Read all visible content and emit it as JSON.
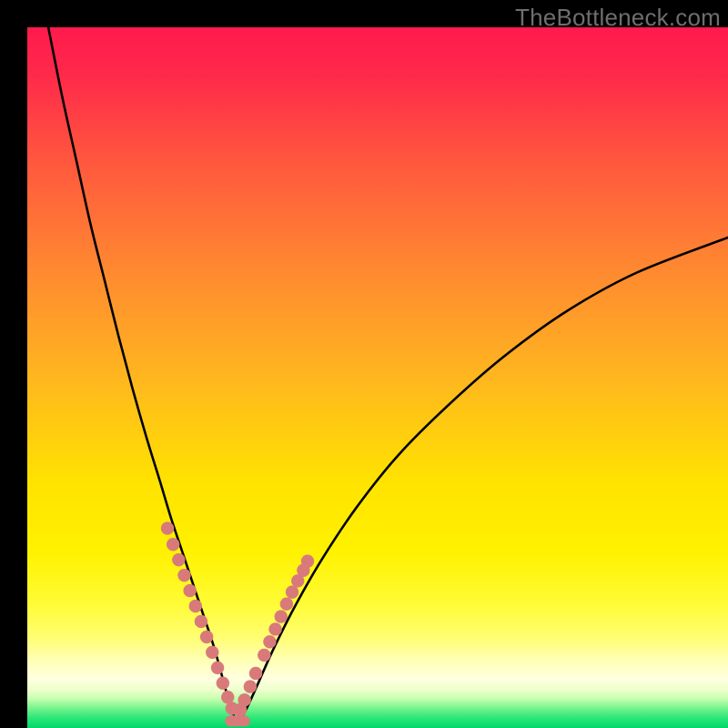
{
  "watermark": "TheBottleneck.com",
  "colors": {
    "frame": "#000000",
    "watermark": "#6e6e6e",
    "curve": "#000000",
    "dots": "#d97a7a",
    "gradient_stops": [
      {
        "offset": 0.0,
        "color": "#ff1a4d"
      },
      {
        "offset": 0.07,
        "color": "#ff2a4a"
      },
      {
        "offset": 0.2,
        "color": "#ff5a3d"
      },
      {
        "offset": 0.35,
        "color": "#ff8a30"
      },
      {
        "offset": 0.5,
        "color": "#ffb61f"
      },
      {
        "offset": 0.65,
        "color": "#ffe300"
      },
      {
        "offset": 0.75,
        "color": "#fff200"
      },
      {
        "offset": 0.82,
        "color": "#fffb33"
      },
      {
        "offset": 0.87,
        "color": "#fffe70"
      },
      {
        "offset": 0.905,
        "color": "#ffffb8"
      },
      {
        "offset": 0.93,
        "color": "#ffffe0"
      },
      {
        "offset": 0.945,
        "color": "#eeffcc"
      },
      {
        "offset": 0.958,
        "color": "#c8ffb0"
      },
      {
        "offset": 0.97,
        "color": "#80f590"
      },
      {
        "offset": 0.985,
        "color": "#2de878"
      },
      {
        "offset": 1.0,
        "color": "#00d86a"
      }
    ]
  },
  "chart_data": {
    "type": "line",
    "title": "",
    "xlabel": "",
    "ylabel": "",
    "xlim": [
      0,
      100
    ],
    "ylim": [
      0,
      100
    ],
    "series": [
      {
        "name": "bottleneck-curve",
        "x": [
          3,
          5,
          7,
          9,
          11,
          13,
          15,
          17,
          19,
          20.5,
          22,
          23.5,
          25,
          26.5,
          27.5,
          28.3,
          29,
          29.5,
          30,
          30.7,
          31.5,
          33,
          35,
          38,
          42,
          47,
          53,
          60,
          68,
          77,
          87,
          100
        ],
        "y": [
          100,
          90,
          81,
          72,
          64,
          56,
          48.5,
          41.5,
          35,
          30,
          25.5,
          21,
          16.5,
          12,
          8.5,
          5.5,
          3.2,
          1.7,
          1.0,
          1.7,
          3.2,
          6.5,
          11,
          17,
          24,
          31.5,
          39,
          46,
          53,
          59.5,
          65,
          70
        ],
        "note": "y is percent of full height above bottom (100=top, 0=bottom); min ~1 at x≈30"
      }
    ],
    "markers": {
      "name": "highlighted-dots",
      "x": [
        20.0,
        20.8,
        21.6,
        22.4,
        23.2,
        24.0,
        24.8,
        25.6,
        26.4,
        27.15,
        27.9,
        28.6,
        29.2,
        30.4,
        31.0,
        31.8,
        32.6,
        33.8,
        34.6,
        35.4,
        36.2,
        37.0,
        37.8,
        38.6,
        39.4,
        40.0
      ],
      "y": [
        28.5,
        26.2,
        24.0,
        21.8,
        19.6,
        17.4,
        15.2,
        13.0,
        10.8,
        8.6,
        6.4,
        4.4,
        2.8,
        2.6,
        4.0,
        5.9,
        7.8,
        10.4,
        12.3,
        14.1,
        15.9,
        17.7,
        19.4,
        21.0,
        22.5,
        23.8
      ]
    },
    "flat_bottom": {
      "x": [
        29.0,
        31.0
      ],
      "y": 1.0
    }
  }
}
